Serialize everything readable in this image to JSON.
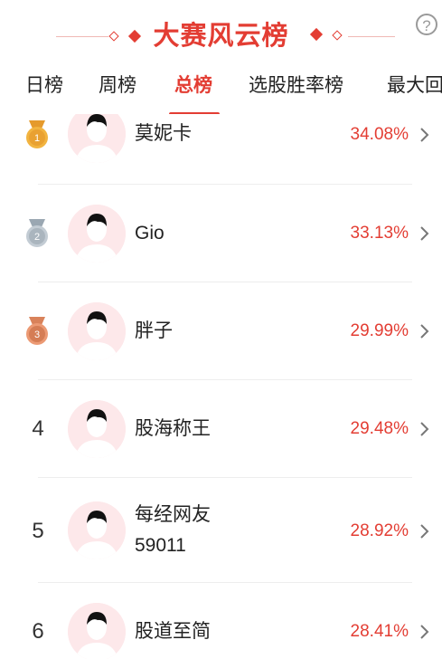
{
  "header": {
    "title": "大赛风云榜",
    "help_icon": "help-circle-icon",
    "accent": "#e33d33"
  },
  "tabs": [
    {
      "label": "日榜",
      "active": false
    },
    {
      "label": "周榜",
      "active": false
    },
    {
      "label": "总榜",
      "active": true
    },
    {
      "label": "选股胜率榜",
      "active": false
    },
    {
      "label": "最大回",
      "active": false
    }
  ],
  "ranking": [
    {
      "rank": "1",
      "name": "莫妮卡",
      "rate": "34.08%",
      "medal": "gold"
    },
    {
      "rank": "2",
      "name": "Gio",
      "rate": "33.13%",
      "medal": "silver"
    },
    {
      "rank": "3",
      "name": "胖子",
      "rate": "29.99%",
      "medal": "bronze"
    },
    {
      "rank": "4",
      "name": "股海称王",
      "rate": "29.48%"
    },
    {
      "rank": "5",
      "name": "每经网友",
      "name2": "59011",
      "rate": "28.92%"
    },
    {
      "rank": "6",
      "name": "股道至简",
      "rate": "28.41%"
    }
  ]
}
